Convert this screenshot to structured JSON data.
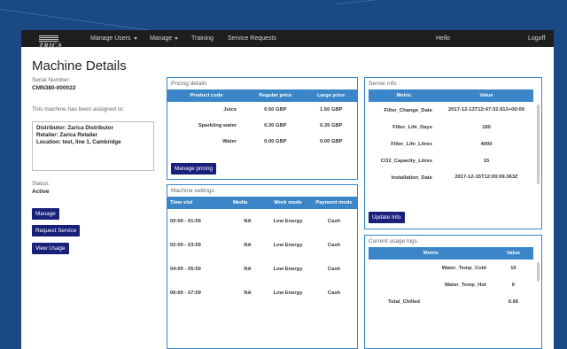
{
  "navbar": {
    "brand": "ZRICA",
    "items": [
      "Manage Users",
      "Manage",
      "Training",
      "Service Requests"
    ],
    "hello": "Hello",
    "logout": "Logoff"
  },
  "page": {
    "title": "Machine Details"
  },
  "machine": {
    "serial_label": "Serial Number:",
    "serial_value": "CMN380-000022",
    "assigned_label": "This machine has been assigned to:",
    "distributor": "Distributor: Zarica Distributor",
    "retailer": "Retailer: Zarica Retailer",
    "location": "Location: test, line 1, Cambridge",
    "status_label": "Status:",
    "status_value": "Active"
  },
  "buttons": {
    "manage": "Manage",
    "request_service": "Request Service",
    "view_usage": "View Usage",
    "manage_pricing": "Manage pricing",
    "update_info": "Update Info"
  },
  "pricing": {
    "title": "Pricing details",
    "headers": [
      "Product code",
      "Regular price",
      "Large price"
    ],
    "rows": [
      [
        "Juice",
        "0.50 GBP",
        "1.50 GBP"
      ],
      [
        "Sparkling water",
        "0.30 GBP",
        "0.35 GBP"
      ],
      [
        "Water",
        "0.00 GBP",
        "0.00 GBP"
      ]
    ]
  },
  "settings": {
    "title": "Machine settings",
    "headers": [
      "Time slot",
      "Media",
      "Work mode",
      "Payment mode"
    ],
    "rows": [
      [
        "00:00 - 01:59",
        "NA",
        "Low Energy",
        "Cash"
      ],
      [
        "02:00 - 03:59",
        "NA",
        "Low Energy",
        "Cash"
      ],
      [
        "04:00 - 05:59",
        "NA",
        "Low Energy",
        "Cash"
      ],
      [
        "06:00 - 07:59",
        "NA",
        "Low Energy",
        "Cash"
      ]
    ]
  },
  "server": {
    "title": "Server info",
    "headers": [
      "Metric",
      "Value"
    ],
    "rows": [
      [
        "Filter_Change_Date",
        "2017-12-13T12:47:32.913+00:00"
      ],
      [
        "Filter_Life_Days",
        "180"
      ],
      [
        "Filter_Life_Litres",
        "4000"
      ],
      [
        "CO2_Capacity_Litres",
        "15"
      ],
      [
        "Installation_Date",
        "2017-12-15T12:00:09.363Z"
      ]
    ]
  },
  "usage": {
    "title": "Current usage logs",
    "headers": [
      "Metric",
      "Value"
    ],
    "rows": [
      [
        "Water_Temp_Cold",
        "10"
      ],
      [
        "Water_Temp_Hot",
        "0"
      ],
      [
        "Total_Chilled",
        "0.66"
      ]
    ]
  }
}
